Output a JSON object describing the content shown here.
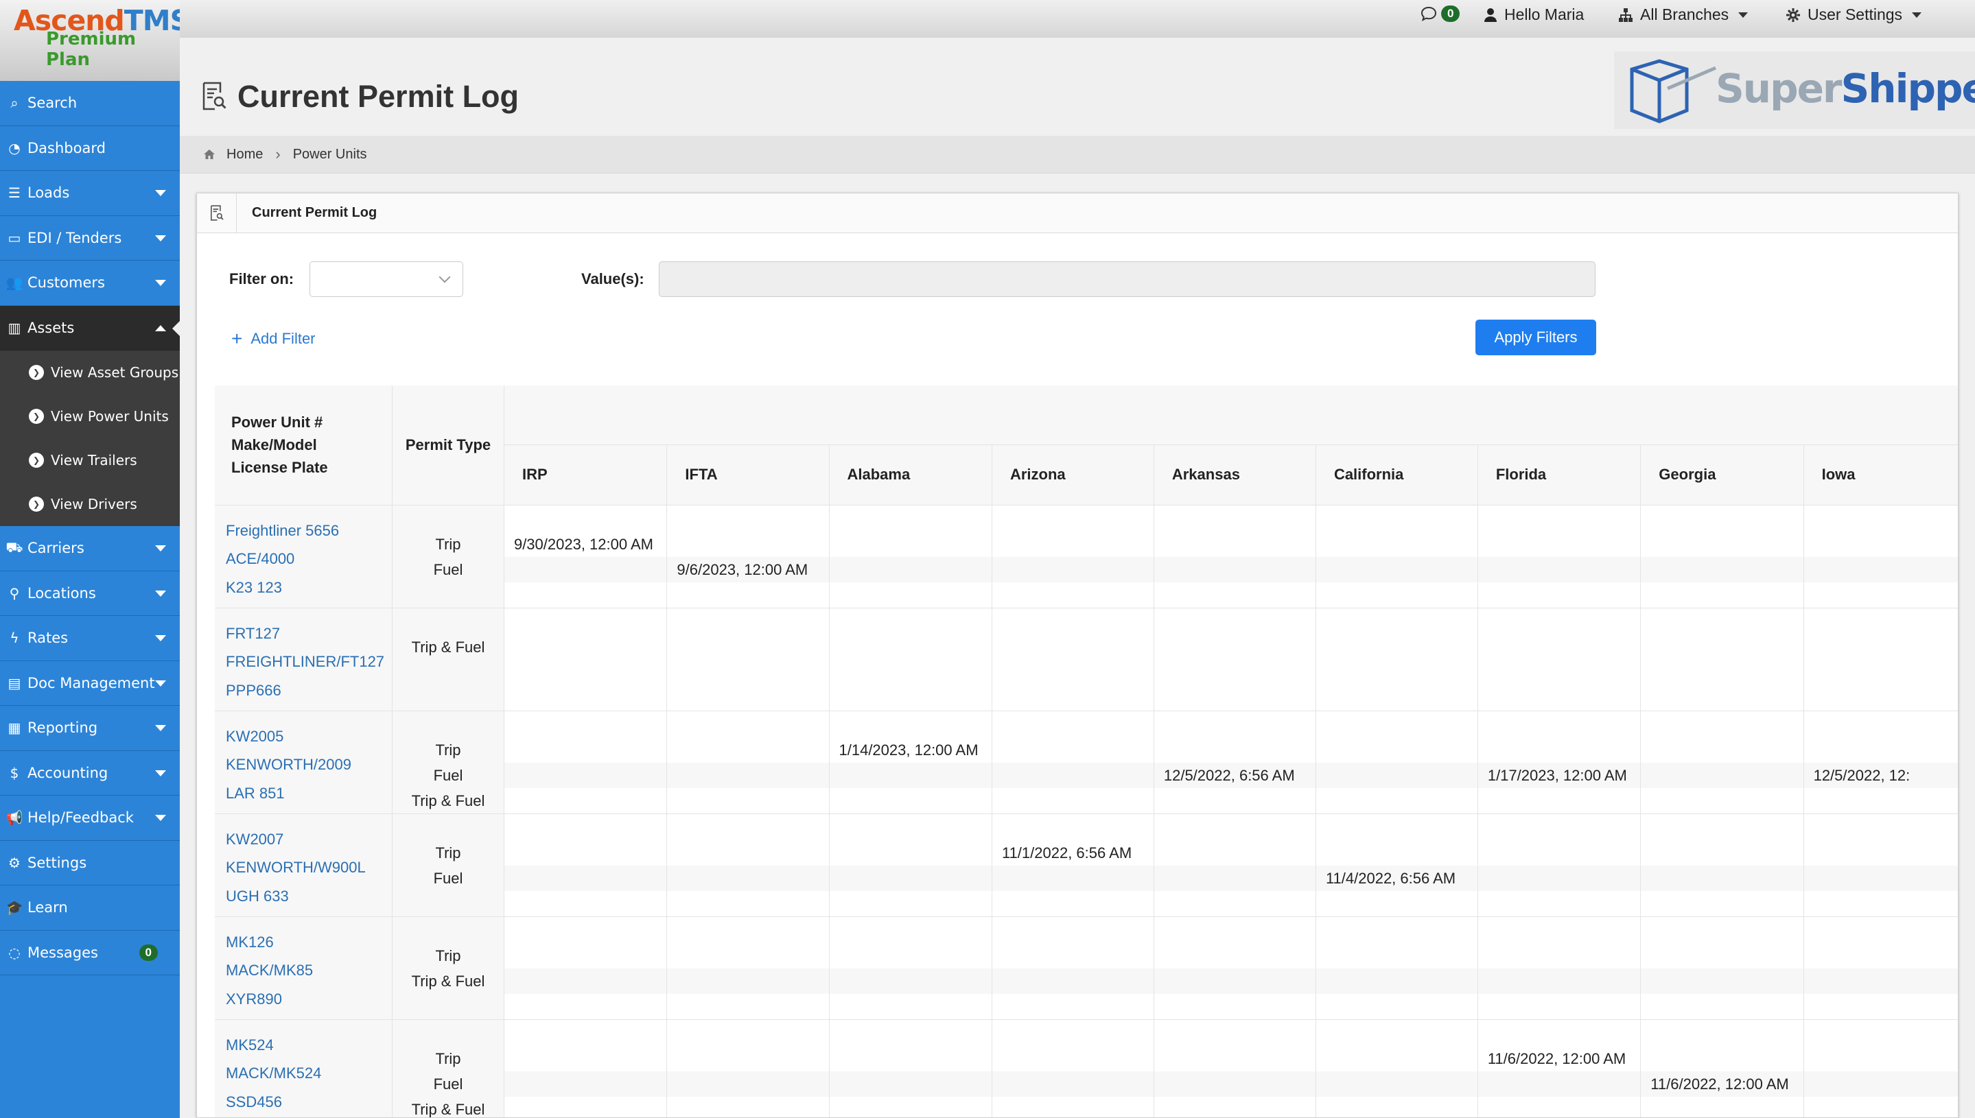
{
  "brand": {
    "name_a": "Ascend",
    "name_b": "TMS",
    "plan": "Premium Plan"
  },
  "topbar": {
    "messages_count": "0",
    "hello": "Hello Maria",
    "branches": "All Branches",
    "user_settings": "User Settings"
  },
  "sidebar": {
    "items": [
      {
        "label": "Search",
        "icon": "search-icon",
        "caret": false
      },
      {
        "label": "Dashboard",
        "icon": "dashboard-icon",
        "caret": false
      },
      {
        "label": "Loads",
        "icon": "list-icon",
        "caret": true
      },
      {
        "label": "EDI / Tenders",
        "icon": "card-icon",
        "caret": true
      },
      {
        "label": "Customers",
        "icon": "users-icon",
        "caret": true
      },
      {
        "label": "Assets",
        "icon": "barcode-icon",
        "caret": true,
        "active": true
      }
    ],
    "sub_items": [
      "View Asset Groups",
      "View Power Units",
      "View Trailers",
      "View Drivers"
    ],
    "items_after": [
      {
        "label": "Carriers",
        "icon": "truck-icon"
      },
      {
        "label": "Locations",
        "icon": "map-marker-icon"
      },
      {
        "label": "Rates",
        "icon": "bolt-icon"
      },
      {
        "label": "Doc Management",
        "icon": "document-icon"
      },
      {
        "label": "Reporting",
        "icon": "file-chart-icon"
      },
      {
        "label": "Accounting",
        "icon": "dollar-icon"
      },
      {
        "label": "Help/Feedback",
        "icon": "megaphone-icon"
      },
      {
        "label": "Settings",
        "icon": "gears-icon"
      },
      {
        "label": "Learn",
        "icon": "graduation-cap-icon"
      },
      {
        "label": "Messages",
        "icon": "chat-icon",
        "badge": "0"
      }
    ]
  },
  "page": {
    "title": "Current Permit Log",
    "logo_a": "Super",
    "logo_b": "Shippers"
  },
  "breadcrumb": {
    "home": "Home",
    "current": "Power Units"
  },
  "panel": {
    "title": "Current Permit Log",
    "filter_label": "Filter on:",
    "values_label": "Value(s):",
    "add_filter": "Add Filter",
    "apply_filters": "Apply Filters"
  },
  "table": {
    "unit_header": [
      "Power Unit #",
      "Make/Model",
      "License Plate"
    ],
    "permit_header": "Permit Type",
    "columns": [
      "IRP",
      "IFTA",
      "Alabama",
      "Arizona",
      "Arkansas",
      "California",
      "Florida",
      "Georgia",
      "Iowa"
    ],
    "rows": [
      {
        "unit": [
          "Freightliner 5656",
          "ACE/4000",
          "K23 123"
        ],
        "permits": [
          "Trip",
          "Fuel"
        ],
        "cells": [
          [
            "9/30/2023, 12:00 AM",
            ""
          ],
          [
            "",
            "9/6/2023, 12:00 AM"
          ],
          [
            "",
            ""
          ],
          [
            "",
            ""
          ],
          [
            "",
            ""
          ],
          [
            "",
            ""
          ],
          [
            "",
            ""
          ],
          [
            "",
            ""
          ],
          [
            "",
            ""
          ]
        ]
      },
      {
        "unit": [
          "FRT127",
          "FREIGHTLINER/FT127",
          "PPP666"
        ],
        "permits": [
          "Trip & Fuel"
        ],
        "cells": [
          [
            ""
          ],
          [
            ""
          ],
          [
            ""
          ],
          [
            ""
          ],
          [
            ""
          ],
          [
            ""
          ],
          [
            ""
          ],
          [
            ""
          ],
          [
            ""
          ]
        ]
      },
      {
        "unit": [
          "KW2005",
          "KENWORTH/2009",
          "LAR 851"
        ],
        "permits": [
          "Trip",
          "Fuel",
          "Trip & Fuel"
        ],
        "cells": [
          [
            "",
            "",
            ""
          ],
          [
            "",
            "",
            ""
          ],
          [
            "1/14/2023, 12:00 AM",
            "",
            ""
          ],
          [
            "",
            "",
            ""
          ],
          [
            "",
            "12/5/2022, 6:56 AM",
            ""
          ],
          [
            "",
            "",
            ""
          ],
          [
            "",
            "1/17/2023, 12:00 AM",
            ""
          ],
          [
            "",
            "",
            ""
          ],
          [
            "",
            "12/5/2022, 12:",
            ""
          ]
        ]
      },
      {
        "unit": [
          "KW2007",
          "KENWORTH/W900L",
          "UGH 633"
        ],
        "permits": [
          "Trip",
          "Fuel"
        ],
        "cells": [
          [
            "",
            ""
          ],
          [
            "",
            ""
          ],
          [
            "",
            ""
          ],
          [
            "11/1/2022, 6:56 AM",
            ""
          ],
          [
            "",
            ""
          ],
          [
            "",
            "11/4/2022, 6:56 AM"
          ],
          [
            "",
            ""
          ],
          [
            "",
            ""
          ],
          [
            "",
            ""
          ]
        ]
      },
      {
        "unit": [
          "MK126",
          "MACK/MK85",
          "XYR890"
        ],
        "permits": [
          "Trip",
          "Trip & Fuel"
        ],
        "cells": [
          [
            "",
            ""
          ],
          [
            "",
            ""
          ],
          [
            "",
            ""
          ],
          [
            "",
            ""
          ],
          [
            "",
            ""
          ],
          [
            "",
            ""
          ],
          [
            "",
            ""
          ],
          [
            "",
            ""
          ],
          [
            "",
            ""
          ]
        ]
      },
      {
        "unit": [
          "MK524",
          "MACK/MK524",
          "SSD456"
        ],
        "permits": [
          "Trip",
          "Fuel",
          "Trip & Fuel"
        ],
        "cells": [
          [
            "",
            "",
            ""
          ],
          [
            "",
            "",
            ""
          ],
          [
            "",
            "",
            ""
          ],
          [
            "",
            "",
            ""
          ],
          [
            "",
            "",
            ""
          ],
          [
            "",
            "",
            ""
          ],
          [
            "11/6/2022, 12:00 AM",
            "",
            ""
          ],
          [
            "",
            "11/6/2022, 12:00 AM",
            ""
          ],
          [
            "",
            "",
            ""
          ]
        ]
      }
    ]
  }
}
